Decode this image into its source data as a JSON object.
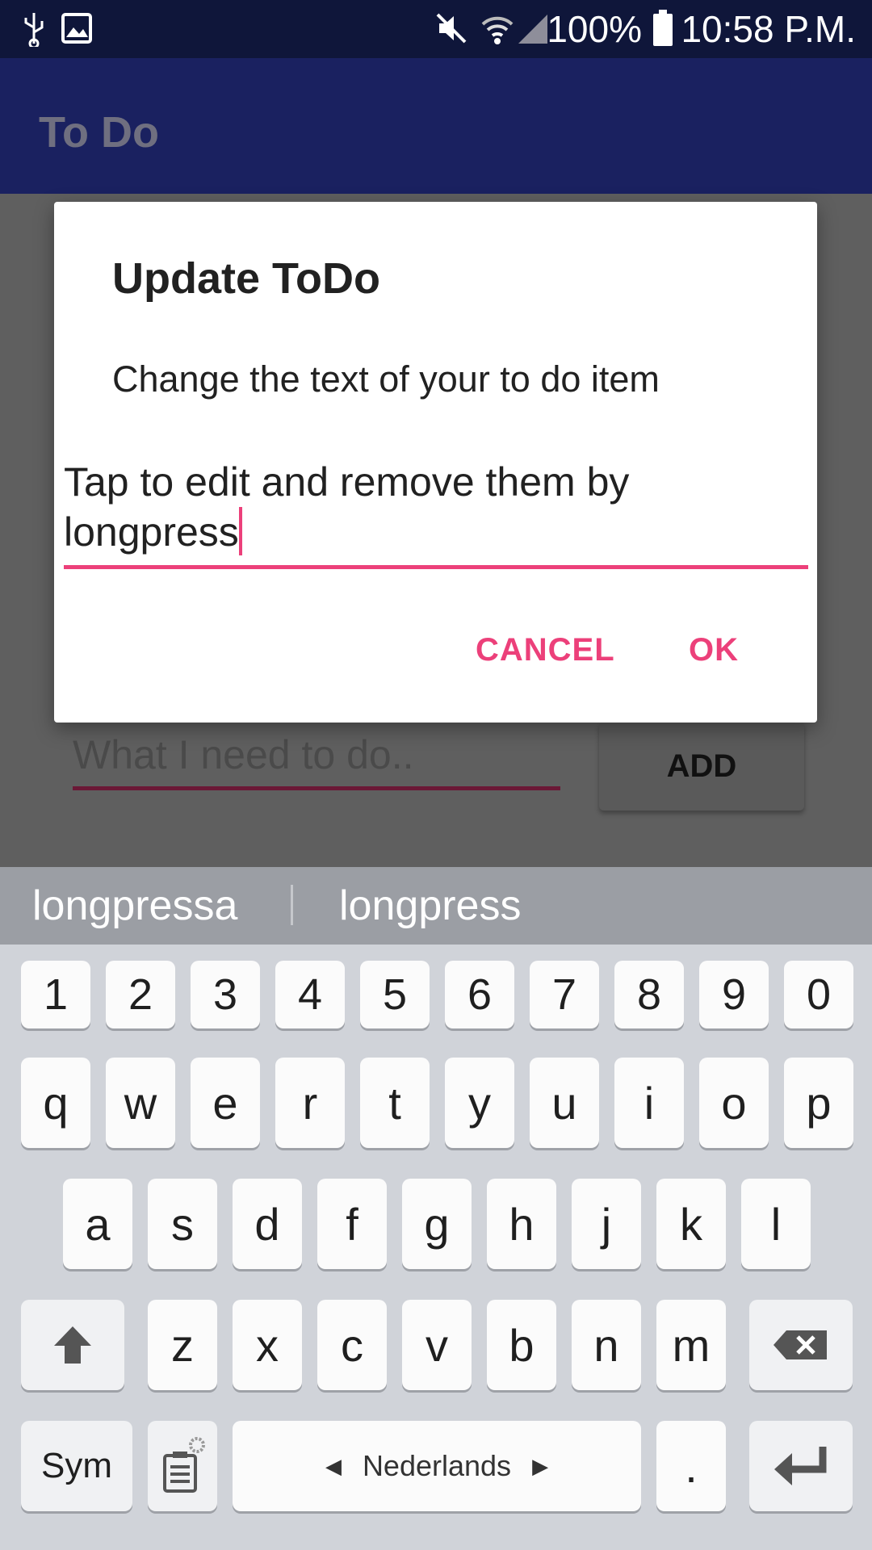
{
  "status_bar": {
    "icons": [
      "usb-icon",
      "image-icon",
      "mute-icon",
      "wifi-icon",
      "signal-icon",
      "battery-icon"
    ],
    "battery": "100%",
    "time": "10:58 P.M."
  },
  "app_bar": {
    "title": "To Do"
  },
  "background": {
    "input_placeholder": "What I need to do..",
    "add_button": "ADD"
  },
  "dialog": {
    "title": "Update ToDo",
    "message": "Change the text of your to do item",
    "input_value": "Tap to edit and remove them by longpress",
    "cancel_label": "CANCEL",
    "ok_label": "OK",
    "accent_color": "#ec407a"
  },
  "suggestions": [
    "longpressa",
    "longpress"
  ],
  "keyboard": {
    "row_numbers": [
      "1",
      "2",
      "3",
      "4",
      "5",
      "6",
      "7",
      "8",
      "9",
      "0"
    ],
    "row1": [
      "q",
      "w",
      "e",
      "r",
      "t",
      "y",
      "u",
      "i",
      "o",
      "p"
    ],
    "row2": [
      "a",
      "s",
      "d",
      "f",
      "g",
      "h",
      "j",
      "k",
      "l"
    ],
    "row3": [
      "z",
      "x",
      "c",
      "v",
      "b",
      "n",
      "m"
    ],
    "sym_label": "Sym",
    "space_label": "Nederlands",
    "period_label": "."
  }
}
